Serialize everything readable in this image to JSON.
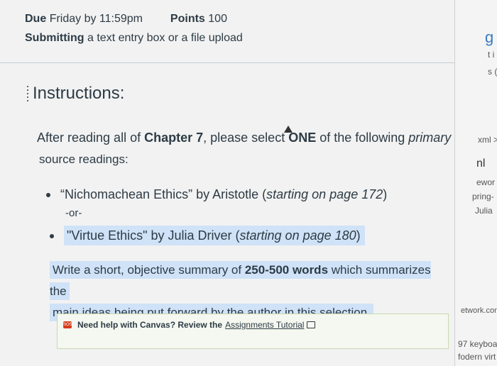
{
  "assignment": {
    "due_label": "Due",
    "due_value": "Friday by 11:59pm",
    "points_label": "Points",
    "points_value": "100",
    "submitting_label": "Submitting",
    "submitting_value": "a text entry box or a file upload"
  },
  "instructions": {
    "title": "Instructions:",
    "intro_before": "After reading all of ",
    "intro_bold": "Chapter 7",
    "intro_mid": ", please select ",
    "intro_bold2": "ONE",
    "intro_after": " of the following ",
    "intro_italic": "primary",
    "intro_line2": "source readings:",
    "reading1_title": "“Nichomachean Ethics” by Aristotle (",
    "reading1_italic": "starting on page 172",
    "reading1_end": ")",
    "or_text": "-or-",
    "reading2_title": "\"Virtue Ethics\" by Julia Driver (",
    "reading2_italic": "starting on page 180",
    "reading2_end": ")",
    "summary_before": "Write a short, objective summary of ",
    "summary_bold": "250-500 words",
    "summary_after1": " which summarizes the",
    "summary_line2": "main ideas being put forward by the author in this selection."
  },
  "help": {
    "text": "Need help with Canvas? Review the",
    "link": "Assignments Tutorial"
  },
  "sidebar": {
    "items": [
      "g",
      "t i",
      "s (",
      "xml >",
      "nl",
      "ewor",
      "pring-",
      "Julia",
      "etwork.con",
      "97 keyboa",
      "fodern virt"
    ]
  }
}
